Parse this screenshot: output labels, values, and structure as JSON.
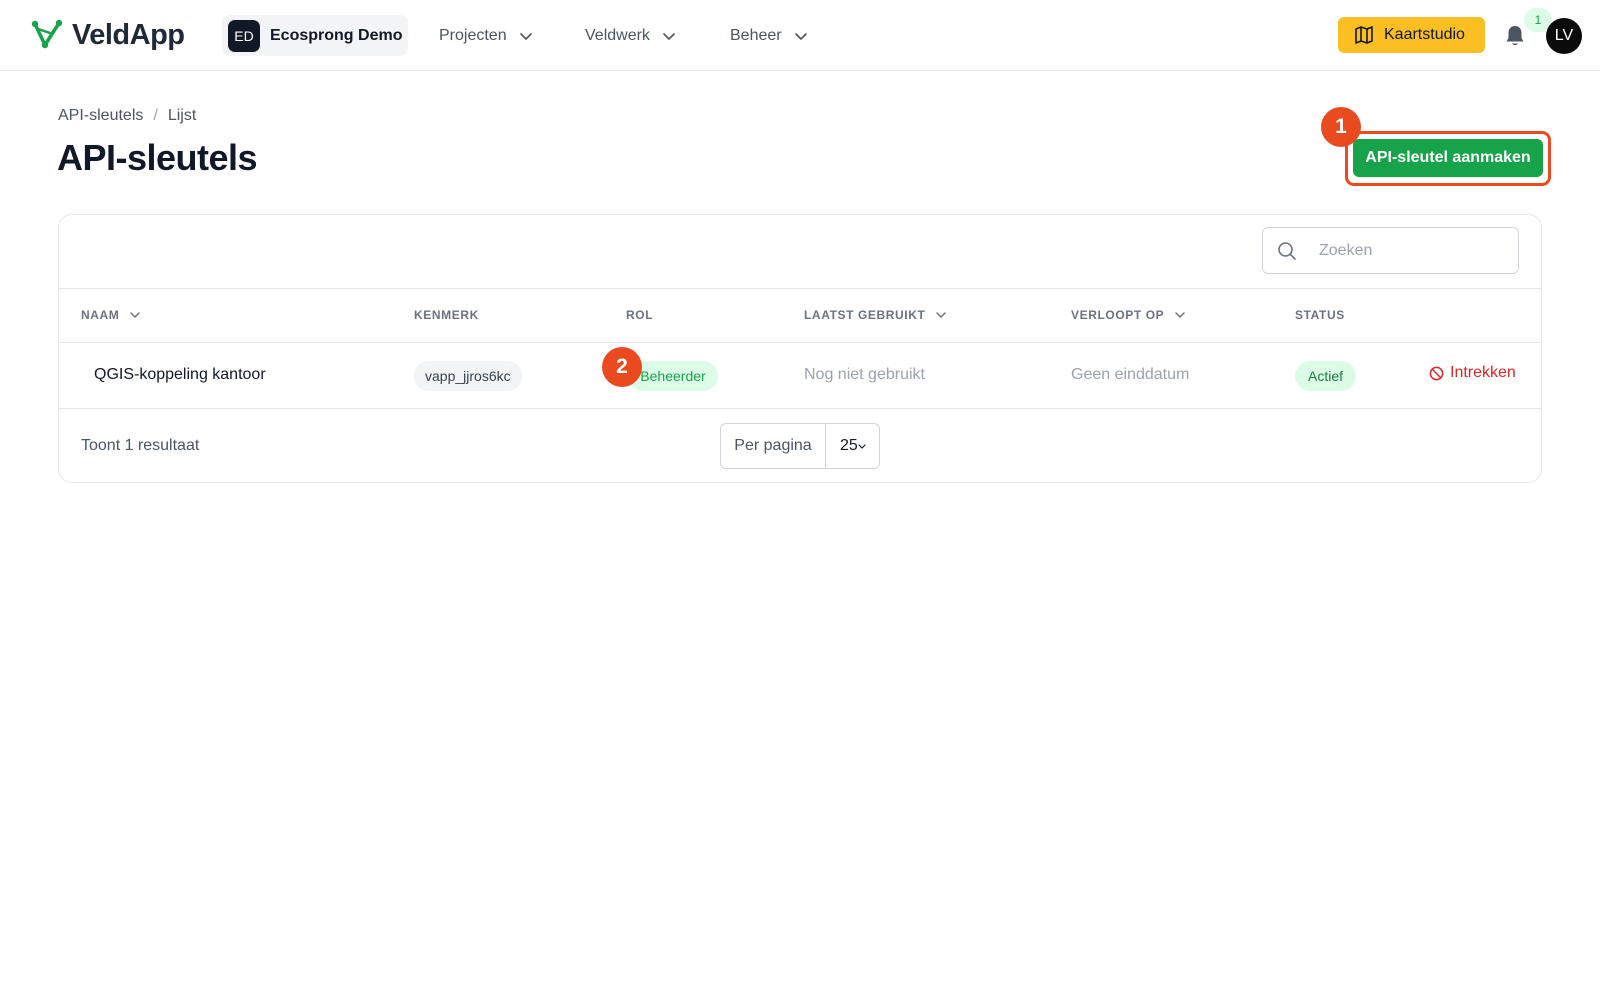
{
  "topbar": {
    "app_name": "VeldApp",
    "tenant_initials": "ED",
    "tenant_name": "Ecosprong Demo",
    "nav": [
      "Projecten",
      "Veldwerk",
      "Beheer"
    ],
    "kaartstudio_label": "Kaartstudio",
    "notification_count": "1",
    "user_initials": "LV"
  },
  "header": {
    "breadcrumb": [
      "API-sleutels",
      "Lijst"
    ],
    "breadcrumb_separator": "/",
    "title": "API-sleutels",
    "create_button_label": "API-sleutel aanmaken"
  },
  "markers": [
    "1",
    "2"
  ],
  "search": {
    "placeholder": "Zoeken",
    "value": ""
  },
  "table": {
    "columns": [
      "NAAM",
      "KENMERK",
      "ROL",
      "LAATST GEBRUIKT",
      "VERLOOPT OP",
      "STATUS"
    ],
    "rows": [
      {
        "name": "QGIS-koppeling kantoor",
        "key": "vapp_jjros6kc",
        "role": "Beheerder",
        "last_used": "Nog niet gebruikt",
        "expires": "Geen einddatum",
        "status": "Actief",
        "action": "Intrekken"
      }
    ]
  },
  "footer": {
    "result_count": "Toont 1 resultaat",
    "per_page_label": "Per pagina",
    "per_page_value": "25"
  },
  "colors": {
    "brand_green": "#16a34a",
    "accent_yellow": "#fbbf24",
    "marker_orange": "#ea4a1f",
    "danger_red": "#dc2626"
  }
}
